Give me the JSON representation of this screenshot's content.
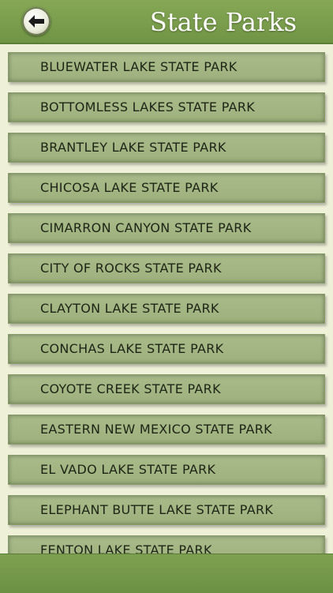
{
  "header": {
    "title": "State Parks",
    "back_icon": "back-arrow-icon"
  },
  "parks": [
    "BLUEWATER LAKE STATE PARK",
    "BOTTOMLESS LAKES STATE PARK",
    "BRANTLEY LAKE STATE PARK",
    "CHICOSA LAKE STATE PARK",
    "CIMARRON CANYON STATE PARK",
    "CITY OF ROCKS STATE PARK",
    "CLAYTON LAKE STATE PARK",
    "CONCHAS LAKE STATE PARK",
    "COYOTE CREEK STATE PARK",
    "EASTERN NEW MEXICO STATE PARK",
    "EL VADO LAKE STATE PARK",
    "ELEPHANT BUTTE LAKE STATE PARK",
    "FENTON LAKE STATE PARK"
  ],
  "colors": {
    "header": "#7a9e4c",
    "row": "#a3b583",
    "background": "#eef0d8"
  }
}
